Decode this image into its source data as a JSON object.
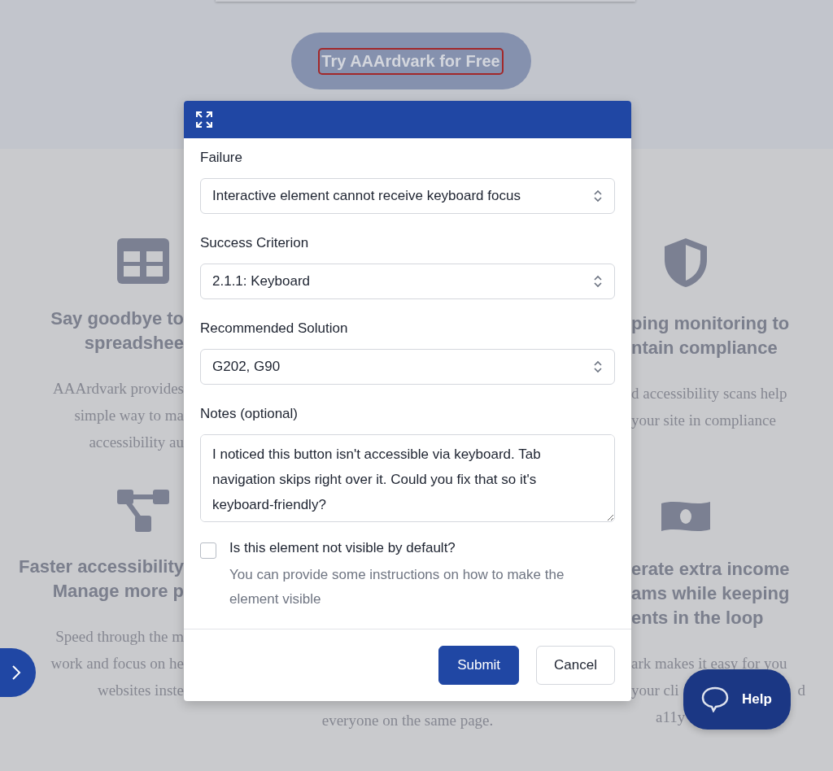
{
  "hero": {
    "cta_button": "Try AAArdvark for Free"
  },
  "features": {
    "left": [
      {
        "title": [
          "Say goodbye to",
          "spreadshee"
        ],
        "text": [
          "AAArdvark provides",
          "simple way to ma",
          "accessibility au"
        ]
      },
      {
        "title": [
          "Faster accessibility",
          "Manage more p"
        ],
        "text": [
          "Speed through the m",
          "work and focus on he",
          "websites inste"
        ]
      }
    ],
    "center": {
      "text": [
        "everyone on the same page."
      ]
    },
    "right": [
      {
        "title": [
          "ping monitoring to",
          "ntain compliance"
        ],
        "text": [
          "d accessibility scans help",
          "your site in compliance"
        ]
      },
      {
        "title": [
          "erate extra income",
          "ams while keeping",
          "ents in the loop"
        ],
        "text": [
          "ark makes it easy for you",
          "your cli",
          "d",
          "a11y"
        ]
      }
    ]
  },
  "dialog": {
    "fields": [
      {
        "label": "Failure",
        "value": "Interactive element cannot receive keyboard focus"
      },
      {
        "label": "Success Criterion",
        "value": "2.1.1: Keyboard"
      },
      {
        "label": "Recommended Solution",
        "value": "G202, G90"
      }
    ],
    "notes": {
      "label": "Notes (optional)",
      "value": "I noticed this button isn't accessible via keyboard. Tab navigation skips right over it. Could you fix that so it's keyboard-friendly?"
    },
    "checkbox": {
      "label": "Is this element not visible by default?",
      "hint": "You can provide some instructions on how to make the element visible",
      "checked": false
    },
    "buttons": {
      "submit": "Submit",
      "cancel": "Cancel"
    }
  },
  "help_button": "Help"
}
